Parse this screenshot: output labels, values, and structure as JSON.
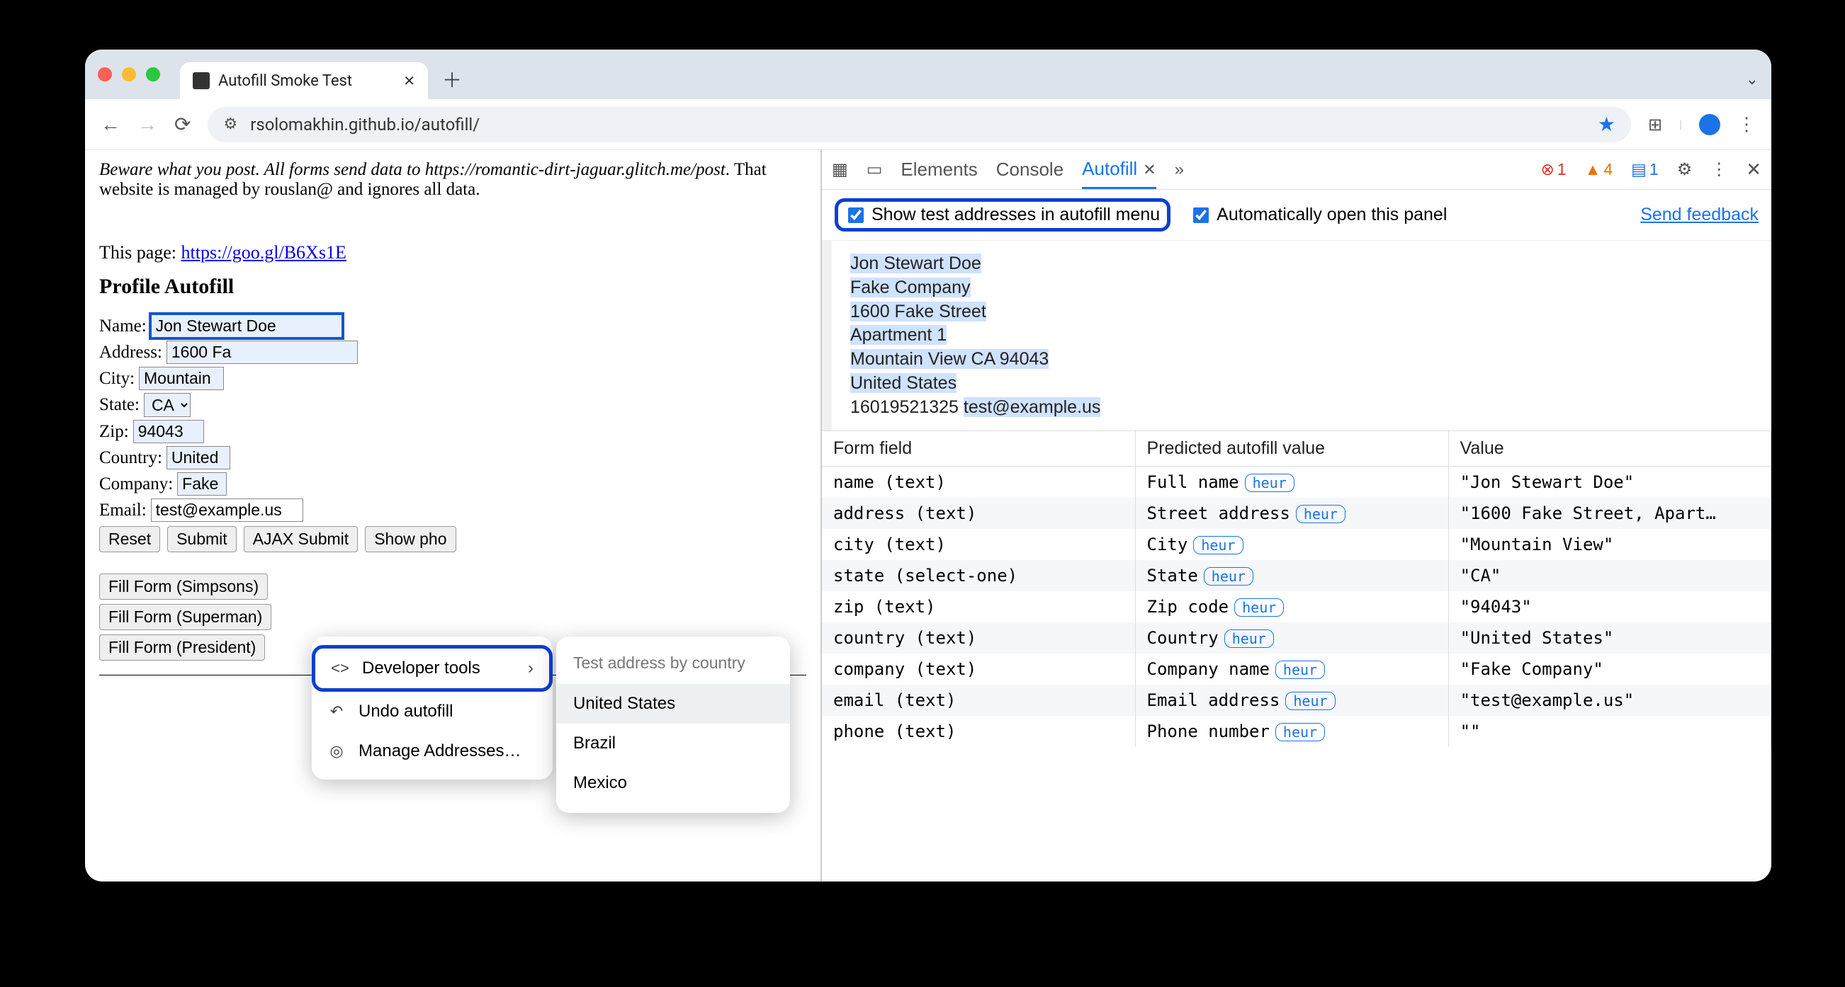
{
  "chrome": {
    "tab_title": "Autofill Smoke Test",
    "url": "rsolomakhin.github.io/autofill/"
  },
  "page": {
    "warning_1": "Beware what you post. All forms send data to https://romantic-dirt-jaguar.glitch.me/post",
    "warning_2": ". That website is managed by rouslan@ and ignores all data.",
    "this_page_label": "This page: ",
    "this_page_link": "https://goo.gl/B6Xs1E",
    "heading": "Profile Autofill",
    "fields": {
      "name_label": "Name:",
      "name_value": "Jon Stewart Doe",
      "address_label": "Address:",
      "address_value": "1600 Fa",
      "city_label": "City:",
      "city_value": "Mountain",
      "state_label": "State:",
      "state_value": "CA",
      "zip_label": "Zip:",
      "zip_value": "94043",
      "country_label": "Country:",
      "country_value": "United",
      "company_label": "Company:",
      "company_value": "Fake",
      "email_label": "Email:",
      "email_value": "test@example.us"
    },
    "buttons": {
      "reset": "Reset",
      "submit": "Submit",
      "ajax": "AJAX Submit",
      "showpho": "Show pho",
      "simpsons": "Fill Form (Simpsons)",
      "superman": "Fill Form (Superman)",
      "president": "Fill Form (President)"
    }
  },
  "context_menu": {
    "dev_tools": "Developer tools",
    "undo": "Undo autofill",
    "manage": "Manage Addresses…"
  },
  "submenu": {
    "header": "Test address by country",
    "us": "United States",
    "br": "Brazil",
    "mx": "Mexico"
  },
  "devtools": {
    "tabs": {
      "elements": "Elements",
      "console": "Console",
      "autofill": "Autofill"
    },
    "counts": {
      "err": "1",
      "warn": "4",
      "info": "1"
    },
    "opt_show_test": "Show test addresses in autofill menu",
    "opt_auto_open": "Automatically open this panel",
    "send_feedback": "Send feedback",
    "address": {
      "name": "Jon Stewart Doe",
      "company": "Fake Company",
      "street": "1600 Fake Street",
      "apt": "Apartment 1",
      "city_state_zip": "Mountain View CA 94043",
      "country": "United States",
      "phone": "16019521325",
      "email": "test@example.us"
    },
    "columns": {
      "field": "Form field",
      "predicted": "Predicted autofill value",
      "value": "Value"
    },
    "rows": [
      {
        "field": "name (text)",
        "predicted": "Full name",
        "value": "\"Jon Stewart Doe\""
      },
      {
        "field": "address (text)",
        "predicted": "Street address",
        "value": "\"1600 Fake Street, Apart…"
      },
      {
        "field": "city (text)",
        "predicted": "City",
        "value": "\"Mountain View\""
      },
      {
        "field": "state (select-one)",
        "predicted": "State",
        "value": "\"CA\""
      },
      {
        "field": "zip (text)",
        "predicted": "Zip code",
        "value": "\"94043\""
      },
      {
        "field": "country (text)",
        "predicted": "Country",
        "value": "\"United States\""
      },
      {
        "field": "company (text)",
        "predicted": "Company name",
        "value": "\"Fake Company\""
      },
      {
        "field": "email (text)",
        "predicted": "Email address",
        "value": "\"test@example.us\""
      },
      {
        "field": "phone (text)",
        "predicted": "Phone number",
        "value": "\"\""
      }
    ],
    "heur_label": "heur"
  }
}
